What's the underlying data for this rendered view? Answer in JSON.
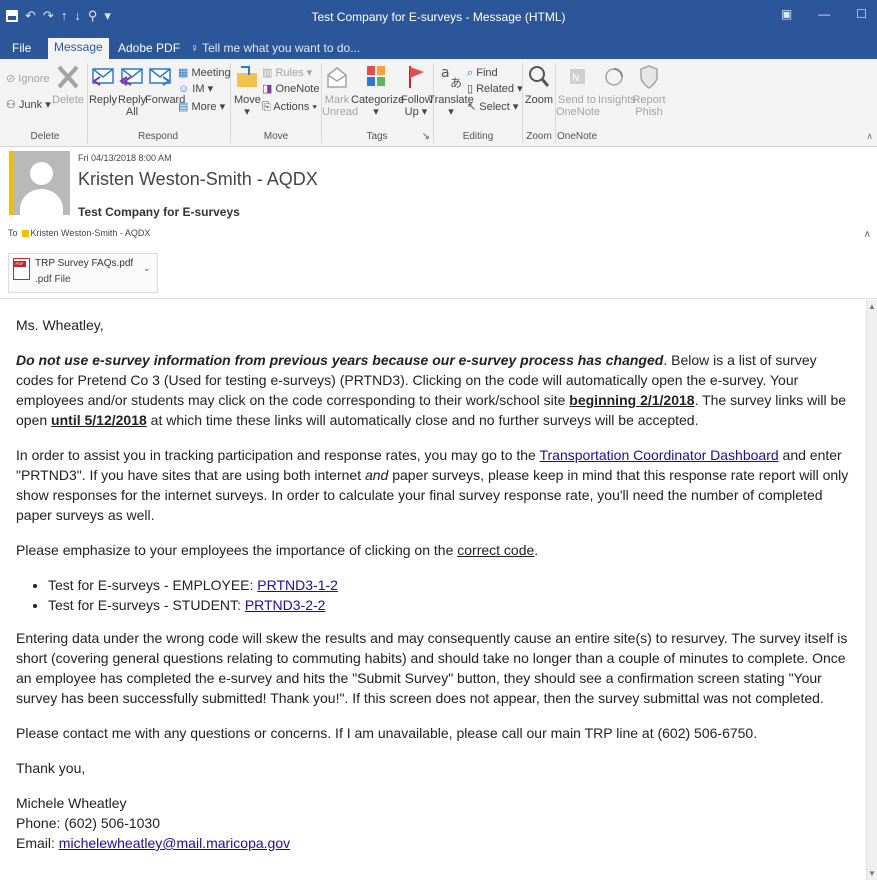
{
  "window": {
    "title": "Test Company for E-surveys - Message (HTML)",
    "qat": {
      "undo": "↶",
      "redo": "↷",
      "up": "↑",
      "down": "↓",
      "touch": "⚲",
      "more": "▾"
    },
    "controls": {
      "restore": "▣",
      "minimize": "—",
      "maximize": "☐"
    }
  },
  "tabs": [
    {
      "label": "File"
    },
    {
      "label": "Message"
    },
    {
      "label": "Adobe PDF"
    },
    {
      "label": "Tell me what you want to do..."
    }
  ],
  "ribbon": {
    "delete_group": {
      "ignore": "Ignore",
      "junk": "Junk",
      "delete": "Delete",
      "label": "Delete"
    },
    "respond_group": {
      "reply": "Reply",
      "reply_all_1": "Reply",
      "reply_all_2": "All",
      "forward": "Forward",
      "meeting": "Meeting",
      "im": "IM",
      "more": "More",
      "label": "Respond"
    },
    "move_group": {
      "move": "Move",
      "rules": "Rules",
      "onenote": "OneNote",
      "actions": "Actions",
      "label": "Move"
    },
    "tags_group": {
      "mark_1": "Mark",
      "mark_2": "Unread",
      "categorize": "Categorize",
      "follow_1": "Follow",
      "follow_2": "Up",
      "label": "Tags"
    },
    "editing_group": {
      "translate": "Translate",
      "find": "Find",
      "related": "Related",
      "select": "Select",
      "label": "Editing"
    },
    "zoom_group": {
      "zoom": "Zoom",
      "label": "Zoom"
    },
    "onenote_group": {
      "send_1": "Send to",
      "send_2": "OneNote",
      "label": "OneNote"
    },
    "insights": "Insights",
    "report_1": "Report",
    "report_2": "Phish"
  },
  "message": {
    "date": "Fri 04/13/2018 8:00 AM",
    "sender": "Kristen Weston-Smith - AQDX",
    "subject": "Test Company for E-surveys",
    "to_label": "To",
    "to_name": "Kristen Weston-Smith - AQDX"
  },
  "attachment": {
    "name": "TRP Survey FAQs.pdf",
    "type": ".pdf File",
    "badge": "PDF"
  },
  "body": {
    "greeting": "Ms. Wheatley,",
    "p1_bold": "Do not use e-survey information from previous years because our e-survey process has changed",
    "p1_a": ". Below is a list of survey codes for Pretend Co 3 (Used for testing e-surveys) (PRTND3). Clicking on the code will automatically open the e-survey. Your employees and/or students may click on the code corresponding to their work/school site ",
    "p1_begin": "beginning 2/1/2018",
    "p1_b": ". The survey links will be open ",
    "p1_until": "until 5/12/2018",
    "p1_c": " at which time these links will automatically close and no further surveys will be accepted.",
    "p2_a": "In order to assist you in tracking participation and response rates, you may go to the ",
    "p2_link": "Transportation Coordinator Dashboard",
    "p2_b": " and enter \"PRTND3\". If you have sites that are using both internet ",
    "p2_and": "and",
    "p2_c": " paper surveys, please keep in mind that this response rate report will only show responses for the internet surveys. In order to calculate your final survey response rate, you'll need the number of completed paper surveys as well.",
    "p3_a": "Please emphasize to your employees the importance of clicking on the ",
    "p3_u": "correct code",
    "p3_b": ".",
    "bullets": [
      {
        "label": "Test for E-surveys - EMPLOYEE: ",
        "code": "PRTND3-1-2"
      },
      {
        "label": "Test for E-surveys - STUDENT: ",
        "code": "PRTND3-2-2"
      }
    ],
    "p4": "Entering data under the wrong code will skew the results and may consequently cause an entire site(s) to resurvey. The survey itself is short (covering general questions relating to commuting habits) and should take no longer than a couple of minutes to complete. Once an employee has completed the e-survey and hits the \"Submit Survey\" button, they should see a confirmation screen stating \"Your survey has been successfully submitted! Thank you!\". If this screen does not appear, then the survey submittal was not completed.",
    "p5": "Please contact me with any questions or concerns. If I am unavailable, please call our main TRP line at (602) 506-6750.",
    "thanks": "Thank you,",
    "sig_name": "Michele Wheatley",
    "sig_phone": "Phone: (602) 506-1030",
    "sig_email_label": "Email: ",
    "sig_email": "michelewheatley@mail.maricopa.gov"
  }
}
